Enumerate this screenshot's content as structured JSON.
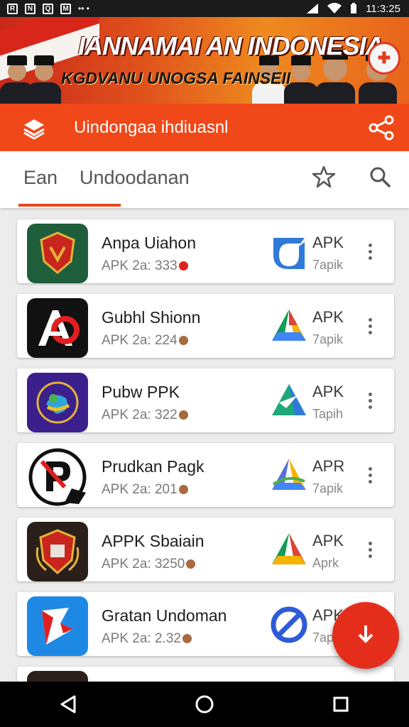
{
  "status_bar": {
    "left_icons": [
      "R",
      "N",
      "Q",
      "M"
    ],
    "time": "11:3:25",
    "icons": [
      "signal-icon",
      "wifi-icon",
      "battery-icon"
    ]
  },
  "banner": {
    "title": "IANNAMAI AN INDONESIA",
    "subtitle": "KGDVANU UNOGSA FAINSEII"
  },
  "app_bar": {
    "title": "Uindongaa ihdiuasnl"
  },
  "tabs": {
    "items": [
      {
        "label": "Ean"
      },
      {
        "label": "Undoodanan"
      }
    ]
  },
  "apps": [
    {
      "title": "Anpa Uiahon",
      "meta": "APK  2a: 333",
      "badge": "APK",
      "sub": "7apik",
      "dot_color": "#e0231b"
    },
    {
      "title": "Gubhl Shionn",
      "meta": "APK  2a: 224",
      "badge": "APK",
      "sub": "7apik",
      "dot_color": "#a86a3f"
    },
    {
      "title": "Pubw PPK",
      "meta": "APK  2a: 322",
      "badge": "APK",
      "sub": "Tapih",
      "dot_color": "#a86a3f"
    },
    {
      "title": "Prudkan Pagk",
      "meta": "APK  2a:  201",
      "badge": "APR",
      "sub": "7apik",
      "dot_color": "#a86a3f"
    },
    {
      "title": "APPK Sbaiain",
      "meta": "APK  2a:  3250",
      "badge": "APK",
      "sub": "Aprk",
      "dot_color": "#a86a3f"
    },
    {
      "title": "Gratan Undoman",
      "meta": "APK  2a: 2.32",
      "badge": "APK",
      "sub": "7apr",
      "dot_color": "#a86a3f"
    }
  ],
  "colors": {
    "accent": "#f04819",
    "fab": "#e52d1b"
  }
}
